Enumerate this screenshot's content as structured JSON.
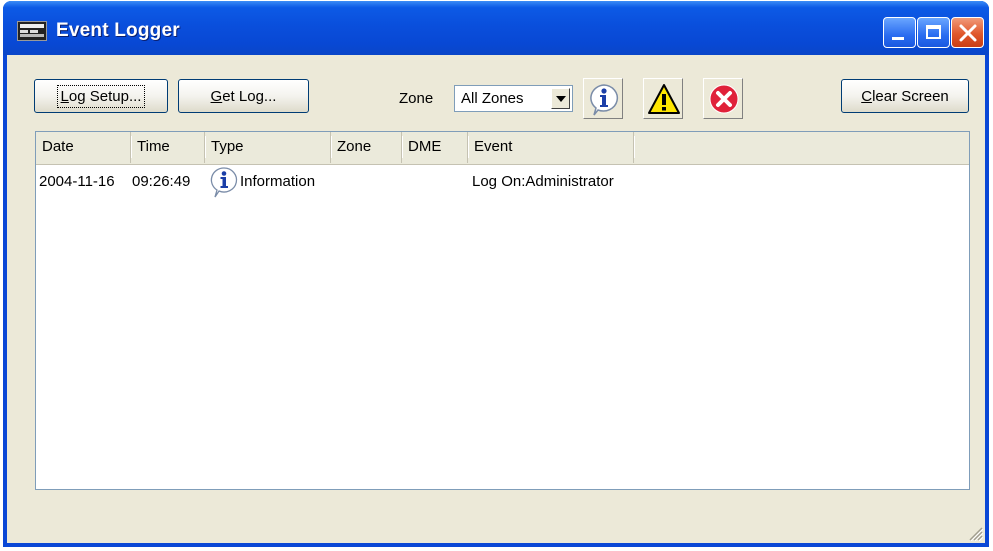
{
  "window": {
    "title": "Event Logger",
    "icon": "dme-app-icon"
  },
  "toolbar": {
    "log_setup_pre": "",
    "log_setup_mnemonic": "L",
    "log_setup_post": "og Setup...",
    "get_log_mnemonic": "G",
    "get_log_post": "et Log...",
    "zone_label": "Zone",
    "zone_value": "All Zones",
    "filter_info_icon": "information-icon",
    "filter_warning_icon": "warning-icon",
    "filter_error_icon": "error-icon",
    "clear_mnemonic": "C",
    "clear_post": "lear Screen"
  },
  "table": {
    "columns": [
      "Date",
      "Time",
      "Type",
      "Zone",
      "DME",
      "Event"
    ],
    "rows": [
      {
        "date": "2004-11-16",
        "time": "09:26:49",
        "type_icon": "information-icon",
        "type": "Information",
        "zone": "",
        "dme": "",
        "event": "Log On:Administrator"
      }
    ]
  },
  "colors": {
    "titlebar": "#0a4fdc",
    "client": "#ece9d8",
    "close_button": "#e0582c"
  }
}
